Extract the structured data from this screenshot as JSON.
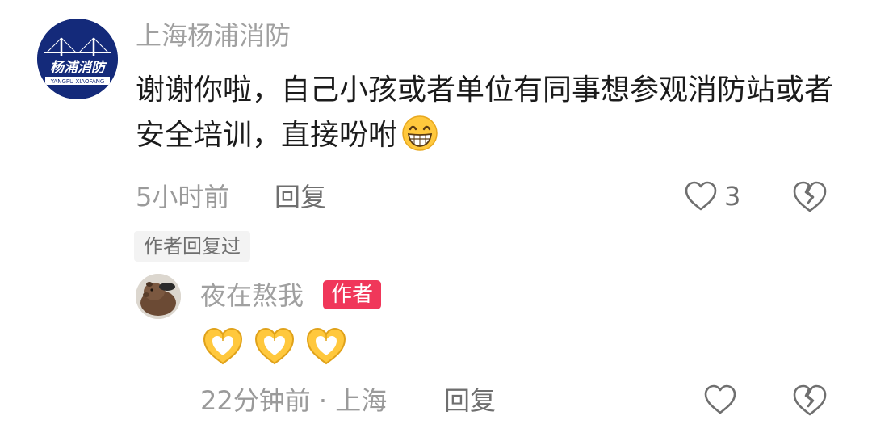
{
  "comment": {
    "author": "上海杨浦消防",
    "avatar_logo_text": "杨浦消防",
    "avatar_logo_subtext": "YANGPU XIAOFANG",
    "text": "谢谢你啦，自己小孩或者单位有同事想参观消防站或者安全培训，直接吩咐",
    "trailing_emoji": "grinning-face-icon",
    "time": "5小时前",
    "reply_label": "回复",
    "like_count": "3",
    "author_replied_tag": "作者回复过"
  },
  "reply": {
    "author": "夜在熬我",
    "badge": "作者",
    "emojis": [
      "heart-hands-icon",
      "heart-hands-icon",
      "heart-hands-icon"
    ],
    "time_location": "22分钟前 · 上海",
    "reply_label": "回复"
  },
  "colors": {
    "author_badge": "#f0375a",
    "avatar_bg": "#142a7a",
    "emoji_yellow": "#ffc83d"
  }
}
